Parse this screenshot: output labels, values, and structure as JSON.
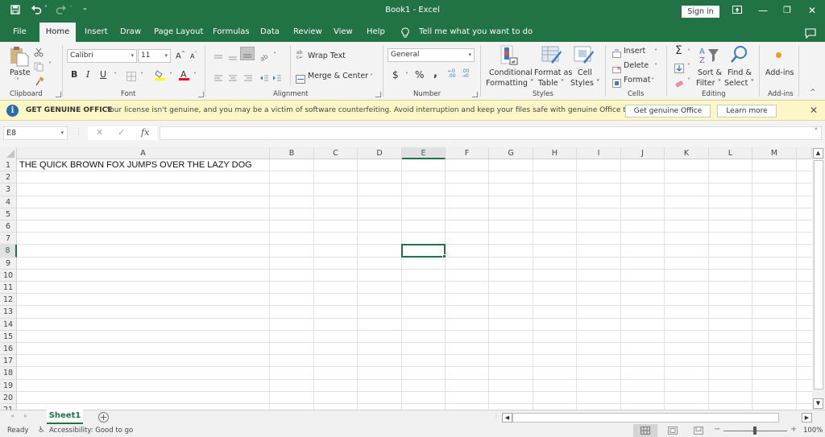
{
  "window": {
    "title": "Book1  -  Excel",
    "sign_in": "Sign in",
    "controls": {
      "ribbon_display": "ribbon-display-icon",
      "minimize": "—",
      "restore": "❐",
      "close": "✕"
    }
  },
  "quick_access": {
    "save": "save-icon",
    "undo": "undo-icon",
    "redo": "redo-icon",
    "customize": "customize-icon"
  },
  "tabs": [
    {
      "label": "File",
      "active": false
    },
    {
      "label": "Home",
      "active": true
    },
    {
      "label": "Insert",
      "active": false
    },
    {
      "label": "Draw",
      "active": false
    },
    {
      "label": "Page Layout",
      "active": false
    },
    {
      "label": "Formulas",
      "active": false
    },
    {
      "label": "Data",
      "active": false
    },
    {
      "label": "Review",
      "active": false
    },
    {
      "label": "View",
      "active": false
    },
    {
      "label": "Help",
      "active": false
    }
  ],
  "tell_me": "Tell me what you want to do",
  "ribbon": {
    "clipboard": {
      "label": "Clipboard",
      "paste": "Paste"
    },
    "font": {
      "label": "Font",
      "name": "Calibri",
      "size": "11",
      "bold": "B",
      "italic": "I",
      "underline": "U",
      "highlight_color": "#ffff00",
      "font_color": "#e81123"
    },
    "alignment": {
      "label": "Alignment",
      "wrap_text": "Wrap Text",
      "merge_center": "Merge & Center"
    },
    "number": {
      "label": "Number",
      "format": "General",
      "currency": "$",
      "percent": "%",
      "comma": ","
    },
    "styles": {
      "label": "Styles",
      "conditional_formatting": [
        "Conditional",
        "Formatting ˅"
      ],
      "format_as_table": [
        "Format as",
        "Table ˅"
      ],
      "cell_styles": [
        "Cell",
        "Styles ˅"
      ]
    },
    "cells": {
      "label": "Cells",
      "insert": "Insert",
      "delete": "Delete",
      "format": "Format"
    },
    "editing": {
      "label": "Editing",
      "sort_filter": [
        "Sort &",
        "Filter ˅"
      ],
      "find_select": [
        "Find &",
        "Select ˅"
      ]
    },
    "addins": {
      "label": "Add-ins",
      "button": "Add-ins"
    }
  },
  "infobar": {
    "title": "GET GENUINE OFFICE",
    "message": "Your license isn't genuine, and you may be a victim of software counterfeiting. Avoid interruption and keep your files safe with genuine Office today.",
    "primary_button": "Get genuine Office",
    "secondary_button": "Learn more"
  },
  "formula_bar": {
    "name_box": "E8",
    "cancel": "✕",
    "enter": "✓",
    "fx": "fx",
    "value": ""
  },
  "sheet": {
    "columns": [
      "A",
      "B",
      "C",
      "D",
      "E",
      "F",
      "G",
      "H",
      "I",
      "J",
      "K",
      "L",
      "M"
    ],
    "rows": [
      "1",
      "2",
      "3",
      "4",
      "5",
      "6",
      "7",
      "8",
      "9",
      "10",
      "11",
      "12",
      "13",
      "14",
      "15",
      "16",
      "17",
      "18",
      "19",
      "20",
      "21"
    ],
    "selected_cell": "E8",
    "selected_column": "E",
    "selected_row": "8",
    "cells": {
      "A1": "THE QUICK BROWN FOX JUMPS OVER THE LAZY DOG"
    }
  },
  "sheet_tabs": [
    {
      "label": "Sheet1",
      "active": true
    }
  ],
  "status": {
    "ready": "Ready",
    "accessibility": "Accessibility: Good to go",
    "zoom": "100%",
    "zoom_minus": "−",
    "zoom_plus": "+"
  },
  "colors": {
    "brand": "#217346",
    "infobar": "#fdf6c5"
  }
}
